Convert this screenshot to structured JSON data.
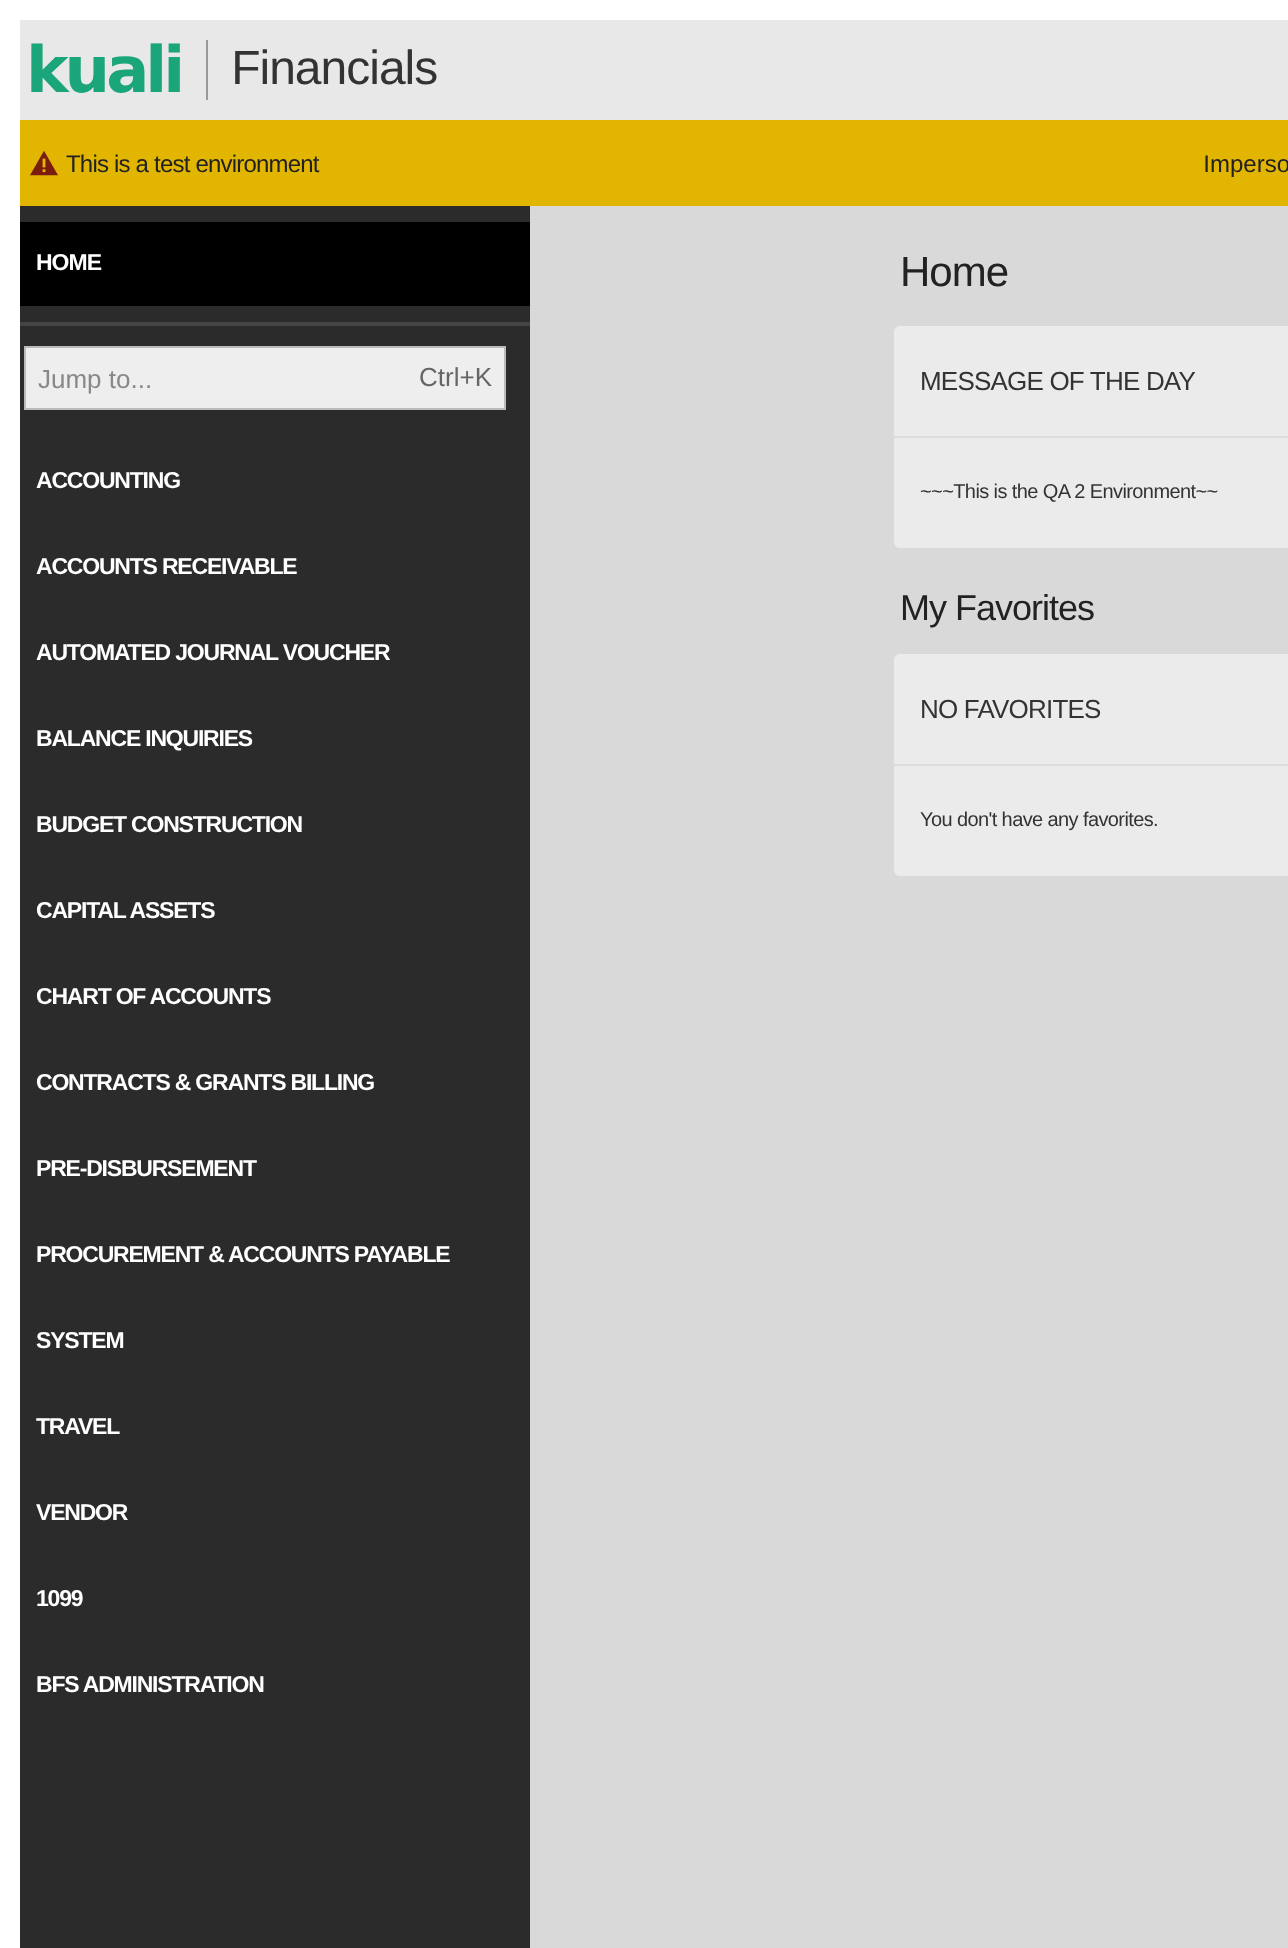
{
  "header": {
    "logo": "kuali",
    "app_name": "Financials"
  },
  "banner": {
    "message": "This is a test environment",
    "right_text": "Imperso"
  },
  "sidebar": {
    "home": {
      "label": "HOME",
      "selected": true
    },
    "jump": {
      "placeholder": "Jump to...",
      "shortcut": "Ctrl+K"
    },
    "items": [
      {
        "label": "ACCOUNTING",
        "selected": false
      },
      {
        "label": "ACCOUNTS RECEIVABLE",
        "selected": false
      },
      {
        "label": "AUTOMATED JOURNAL VOUCHER",
        "selected": false
      },
      {
        "label": "BALANCE INQUIRIES",
        "selected": false
      },
      {
        "label": "BUDGET CONSTRUCTION",
        "selected": false
      },
      {
        "label": "CAPITAL ASSETS",
        "selected": false
      },
      {
        "label": "CHART OF ACCOUNTS",
        "selected": false
      },
      {
        "label": "CONTRACTS & GRANTS BILLING",
        "selected": false
      },
      {
        "label": "PRE-DISBURSEMENT",
        "selected": false
      },
      {
        "label": "PROCUREMENT & ACCOUNTS PAYABLE",
        "selected": false
      },
      {
        "label": "SYSTEM",
        "selected": false
      },
      {
        "label": "TRAVEL",
        "selected": false
      },
      {
        "label": "VENDOR",
        "selected": false
      },
      {
        "label": "1099",
        "selected": false
      },
      {
        "label": "BFS ADMINISTRATION",
        "selected": false
      }
    ]
  },
  "main": {
    "title": "Home",
    "sections": [
      {
        "card_title": "MESSAGE OF THE DAY",
        "card_body": "~~~This is the QA 2 Environment~~"
      },
      {
        "heading": "My Favorites",
        "card_title": "NO FAVORITES",
        "card_body": "You don't have any favorites."
      }
    ]
  }
}
